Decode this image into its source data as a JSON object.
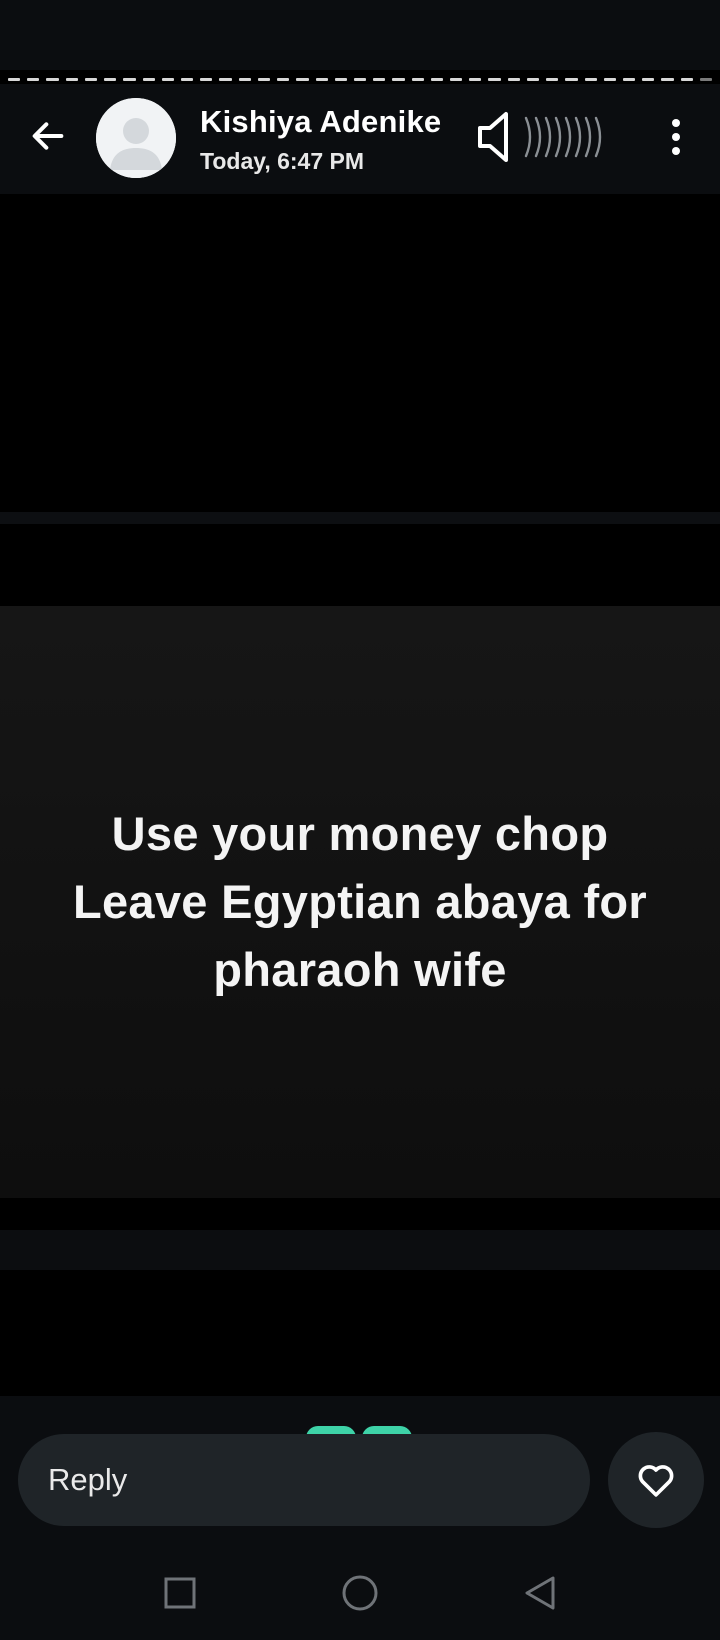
{
  "contact": {
    "name": "Kishiya Adenike",
    "timestamp": "Today, 6:47 PM"
  },
  "status_post": {
    "lines": [
      "Use your money chop",
      "Leave Egyptian abaya for",
      "pharaoh wife"
    ],
    "story_segments_total": 37,
    "story_segments_viewed": 36
  },
  "reply": {
    "placeholder": "Reply"
  },
  "icons": {
    "back": "arrow-left-icon",
    "avatar": "default-avatar-icon",
    "mute": "speaker-volume-icon",
    "more": "more-vertical-icon",
    "like": "heart-icon",
    "nav_recents": "square-icon",
    "nav_home": "circle-icon",
    "nav_back": "triangle-back-icon"
  },
  "colors": {
    "background": "#000000",
    "header": "#0b0d10",
    "reply_field": "#1f2428",
    "reaction_accent": "#3ed3a8"
  }
}
